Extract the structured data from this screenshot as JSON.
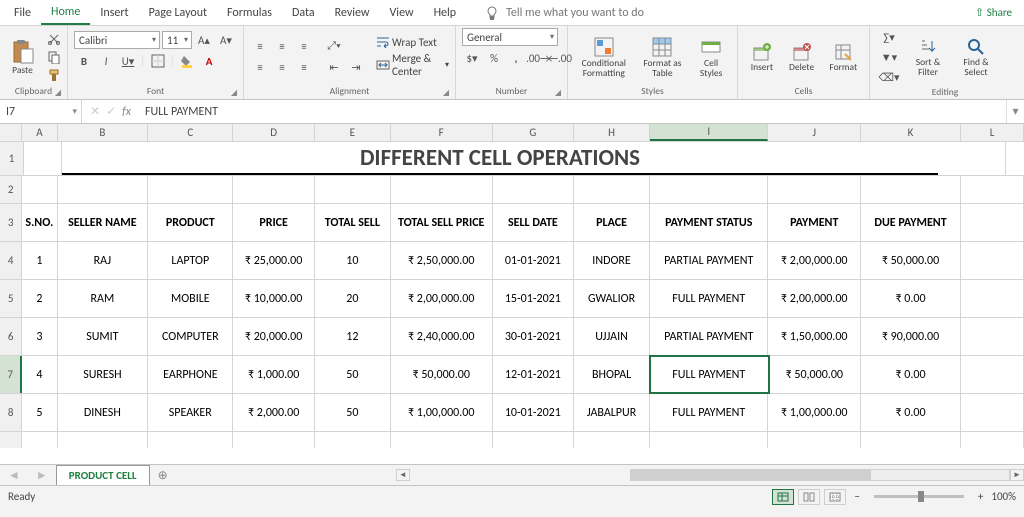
{
  "tabs": [
    "File",
    "Home",
    "Insert",
    "Page Layout",
    "Formulas",
    "Data",
    "Review",
    "View",
    "Help"
  ],
  "active_tab": "Home",
  "tell_me": "Tell me what you want to do",
  "share": "Share",
  "clipboard": {
    "paste": "Paste",
    "label": "Clipboard"
  },
  "font": {
    "name": "Calibri",
    "size": "11",
    "label": "Font",
    "bold": "B",
    "italic": "I",
    "underline": "U"
  },
  "alignment": {
    "wrap": "Wrap Text",
    "merge": "Merge & Center",
    "label": "Alignment"
  },
  "number": {
    "general": "General",
    "label": "Number"
  },
  "styles": {
    "cond": "Conditional\nFormatting",
    "table": "Format as\nTable",
    "cell": "Cell\nStyles",
    "label": "Styles"
  },
  "cells": {
    "insert": "Insert",
    "delete": "Delete",
    "format": "Format",
    "label": "Cells"
  },
  "editing": {
    "sort": "Sort &\nFilter",
    "find": "Find &\nSelect",
    "label": "Editing"
  },
  "name_box": "I7",
  "fx_value": "FULL PAYMENT",
  "columns": [
    "A",
    "B",
    "C",
    "D",
    "E",
    "F",
    "G",
    "H",
    "I",
    "J",
    "K",
    "L"
  ],
  "title": "DIFFERENT CELL OPERATIONS",
  "headers": [
    "S.NO.",
    "SELLER NAME",
    "PRODUCT",
    "PRICE",
    "TOTAL SELL",
    "TOTAL SELL PRICE",
    "SELL DATE",
    "PLACE",
    "PAYMENT STATUS",
    "PAYMENT",
    "DUE PAYMENT"
  ],
  "rows": [
    [
      "1",
      "RAJ",
      "LAPTOP",
      "₹ 25,000.00",
      "10",
      "₹ 2,50,000.00",
      "01-01-2021",
      "INDORE",
      "PARTIAL PAYMENT",
      "₹ 2,00,000.00",
      "₹ 50,000.00"
    ],
    [
      "2",
      "RAM",
      "MOBILE",
      "₹ 10,000.00",
      "20",
      "₹ 2,00,000.00",
      "15-01-2021",
      "GWALIOR",
      "FULL PAYMENT",
      "₹ 2,00,000.00",
      "₹ 0.00"
    ],
    [
      "3",
      "SUMIT",
      "COMPUTER",
      "₹ 20,000.00",
      "12",
      "₹ 2,40,000.00",
      "30-01-2021",
      "UJJAIN",
      "PARTIAL PAYMENT",
      "₹ 1,50,000.00",
      "₹ 90,000.00"
    ],
    [
      "4",
      "SURESH",
      "EARPHONE",
      "₹ 1,000.00",
      "50",
      "₹ 50,000.00",
      "12-01-2021",
      "BHOPAL",
      "FULL PAYMENT",
      "₹ 50,000.00",
      "₹ 0.00"
    ],
    [
      "5",
      "DINESH",
      "SPEAKER",
      "₹ 2,000.00",
      "50",
      "₹ 1,00,000.00",
      "10-01-2021",
      "JABALPUR",
      "FULL PAYMENT",
      "₹ 1,00,000.00",
      "₹ 0.00"
    ]
  ],
  "sheet_tab": "PRODUCT CELL",
  "status": "Ready",
  "zoom": "100%"
}
